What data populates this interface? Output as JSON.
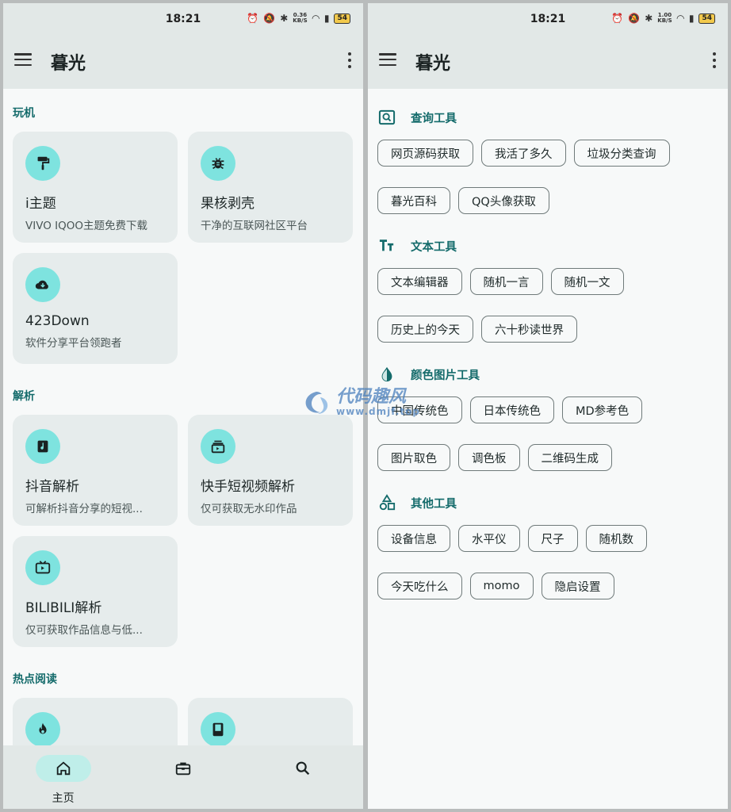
{
  "left": {
    "status": {
      "time": "18:21",
      "net_speed": "0.36",
      "net_unit": "KB/S",
      "battery": "54"
    },
    "appbar": {
      "title": "暮光"
    },
    "sections": [
      {
        "title": "玩机",
        "cards": [
          {
            "name": "i主题",
            "desc": "VIVO IQOO主题免费下载",
            "icon": "paint-roller-icon"
          },
          {
            "name": "果核剥壳",
            "desc": "干净的互联网社区平台",
            "icon": "bug-icon"
          },
          {
            "name": "423Down",
            "desc": "软件分享平台领跑者",
            "icon": "cloud-download-icon"
          }
        ]
      },
      {
        "title": "解析",
        "cards": [
          {
            "name": "抖音解析",
            "desc": "可解析抖音分享的短视...",
            "icon": "music-note-icon"
          },
          {
            "name": "快手短视频解析",
            "desc": "仅可获取无水印作品",
            "icon": "video-stack-icon"
          },
          {
            "name": "BILIBILI解析",
            "desc": "仅可获取作品信息与低...",
            "icon": "tv-icon"
          }
        ]
      },
      {
        "title": "热点阅读",
        "cards": [
          {
            "name": "",
            "desc": "",
            "icon": "flame-icon"
          },
          {
            "name": "",
            "desc": "",
            "icon": "book-icon"
          }
        ]
      }
    ],
    "bottom_nav": [
      {
        "label": "主页",
        "icon": "home-icon",
        "active": true
      },
      {
        "label": "",
        "icon": "toolbox-icon",
        "active": false
      },
      {
        "label": "",
        "icon": "search-icon",
        "active": false
      }
    ]
  },
  "right": {
    "status": {
      "time": "18:21",
      "net_speed": "1.00",
      "net_unit": "KB/S",
      "battery": "54"
    },
    "appbar": {
      "title": "暮光"
    },
    "tool_sections": [
      {
        "title": "查询工具",
        "icon": "search-box-icon",
        "rows": [
          [
            "网页源码获取",
            "我活了多久",
            "垃圾分类查询"
          ],
          [
            "暮光百科",
            "QQ头像获取"
          ]
        ]
      },
      {
        "title": "文本工具",
        "icon": "text-size-icon",
        "rows": [
          [
            "文本编辑器",
            "随机一言",
            "随机一文"
          ],
          [
            "历史上的今天",
            "六十秒读世界"
          ]
        ]
      },
      {
        "title": "颜色图片工具",
        "icon": "water-drop-icon",
        "rows": [
          [
            "中国传统色",
            "日本传统色",
            "MD参考色"
          ],
          [
            "图片取色",
            "调色板",
            "二维码生成"
          ]
        ]
      },
      {
        "title": "其他工具",
        "icon": "shapes-icon",
        "rows": [
          [
            "设备信息",
            "水平仪",
            "尺子",
            "随机数"
          ],
          [
            "今天吃什么",
            "momo",
            "隐启设置"
          ]
        ]
      }
    ]
  },
  "watermark": {
    "text": "代码趣风",
    "url": "www.dmjf.top"
  },
  "colors": {
    "accent": "#146b6b",
    "icon_circle": "#7ee3df",
    "card_bg": "#e6ecec",
    "bar_bg": "#e2e8e7",
    "nav_active": "#bfeee9"
  }
}
